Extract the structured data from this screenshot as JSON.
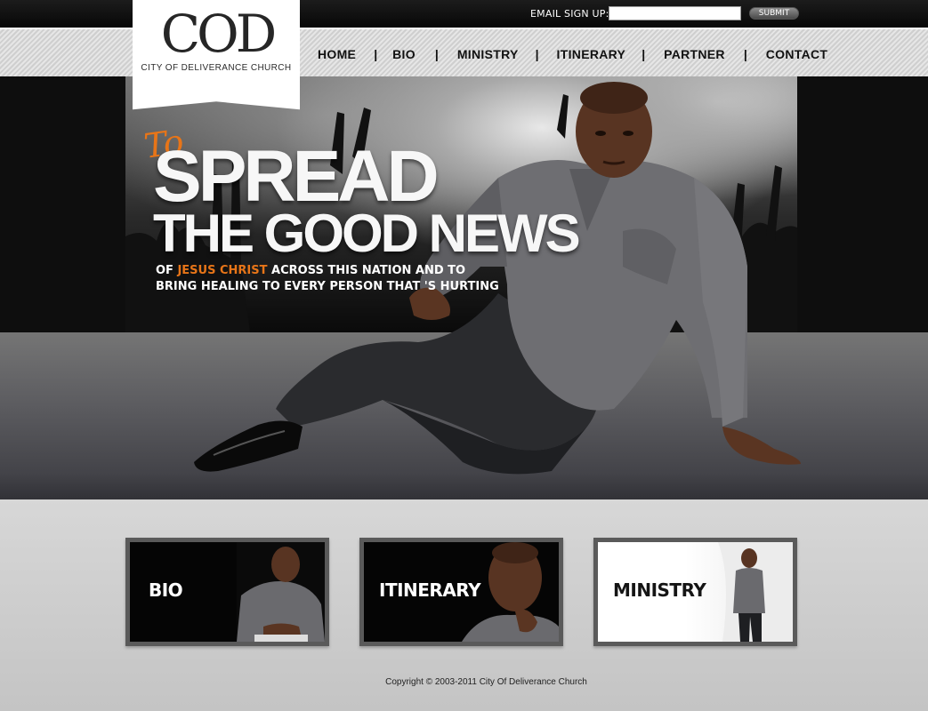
{
  "header": {
    "signup_label": "EMAIL SIGN UP:",
    "signup_placeholder": "",
    "submit_label": "SUBMIT"
  },
  "logo": {
    "mark": "COD",
    "subtitle": "CITY OF DELIVERANCE CHURCH"
  },
  "nav": {
    "items": [
      "HOME",
      "BIO",
      "MINISTRY",
      "ITINERARY",
      "PARTNER",
      "CONTACT"
    ],
    "separator": "|"
  },
  "hero": {
    "to": "To",
    "headline1": "SPREAD",
    "headline2": "THE GOOD NEWS",
    "line1_prefix": "OF ",
    "line1_accent": "JESUS CHRIST",
    "line1_suffix": " ACROSS THIS NATION AND TO",
    "line2": "BRING HEALING TO EVERY PERSON THAT 'S HURTING"
  },
  "cards": [
    {
      "title": "BIO"
    },
    {
      "title": "ITINERARY"
    },
    {
      "title": "MINISTRY"
    }
  ],
  "footer": {
    "copyright": "Copyright © 2003-2011 City Of Deliverance Church"
  },
  "colors": {
    "accent": "#e87518",
    "dark": "#0e0e0e",
    "page_bg": "#c9c9c9"
  }
}
